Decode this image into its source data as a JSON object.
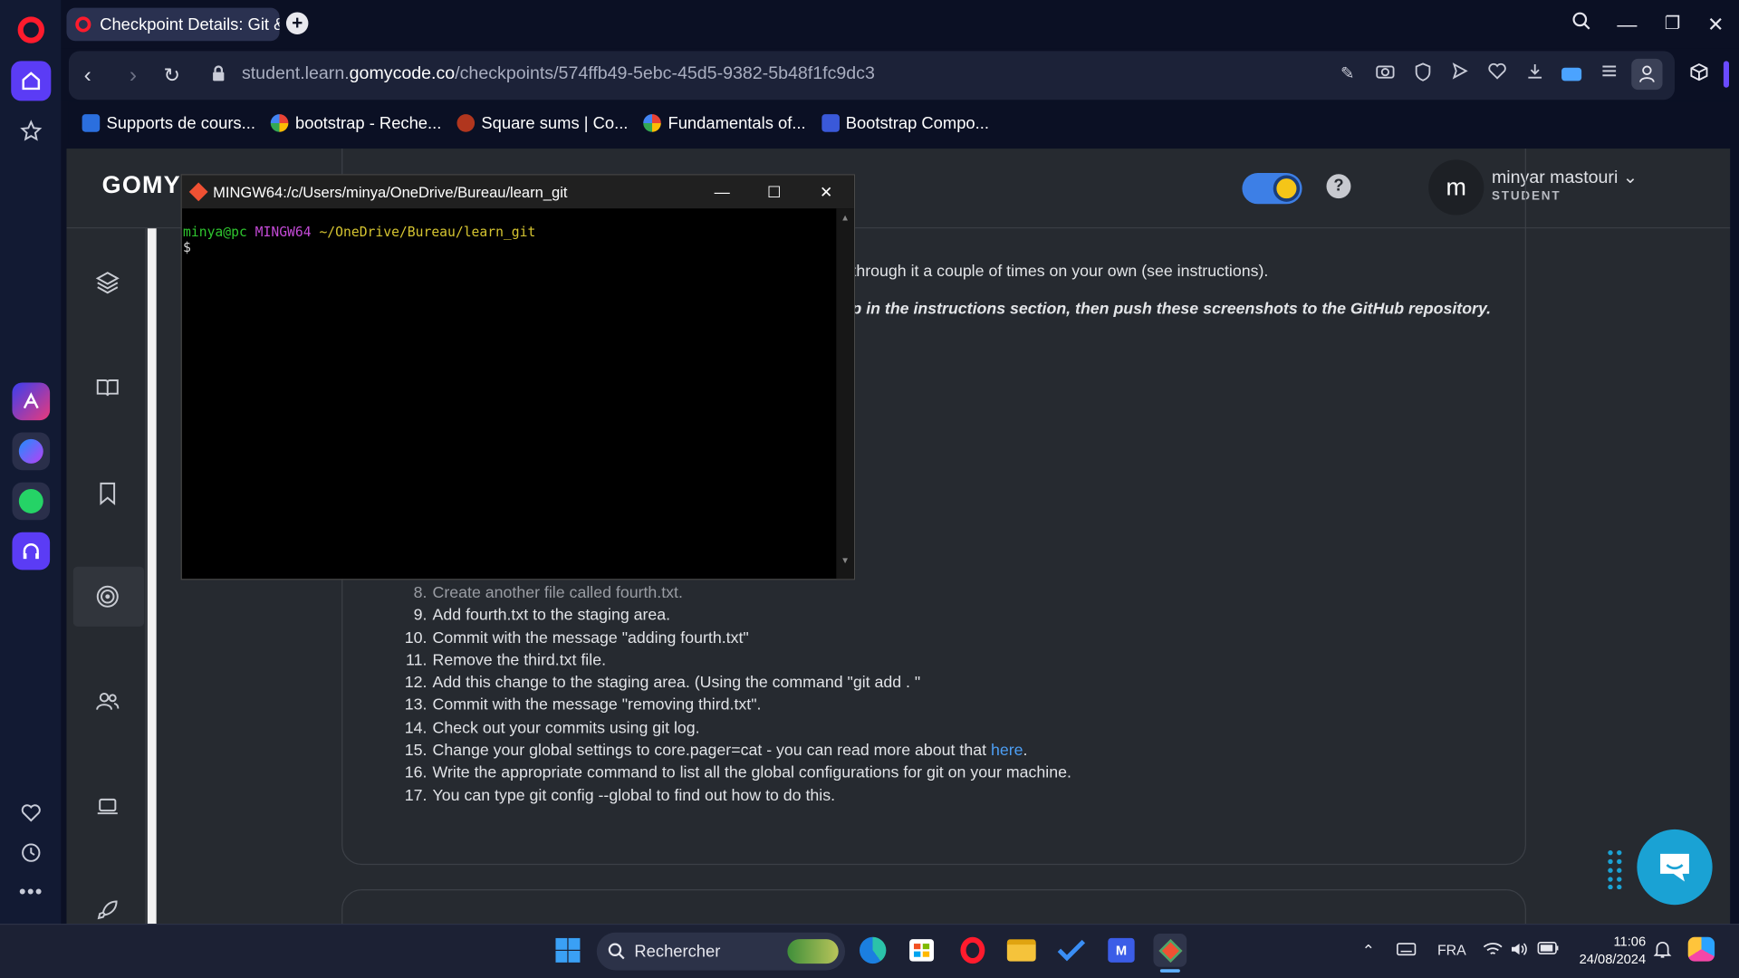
{
  "browser": {
    "tab_title": "Checkpoint Details: Git &",
    "url_prefix": "student.learn.",
    "url_domain": "gomycode.co",
    "url_path": "/checkpoints/574ffb49-5ebc-45d5-9382-5b48f1fc9dc3",
    "bookmarks": [
      {
        "label": "Supports de cours...",
        "icon": "screen-icon",
        "color": "#2b6fde"
      },
      {
        "label": "bootstrap - Reche...",
        "icon": "google-icon",
        "color": "#ffffff"
      },
      {
        "label": "Square sums | Co...",
        "icon": "codewars-icon",
        "color": "#b1361e"
      },
      {
        "label": "Fundamentals of...",
        "icon": "google-icon",
        "color": "#ffffff"
      },
      {
        "label": "Bootstrap Compo...",
        "icon": "bookmark-app-icon",
        "color": "#3a59d9"
      }
    ]
  },
  "site": {
    "logo": "GOMY",
    "user_initial": "m",
    "user_name": "minyar mastouri",
    "user_role": "STUDENT"
  },
  "content": {
    "line1": "through it a couple of times on your own (see instructions).",
    "line2": "p in the instructions section, then push these screenshots to the GitHub repository.",
    "steps": [
      {
        "num": "8.",
        "text": "Create another file called fourth.txt."
      },
      {
        "num": "9.",
        "text": "Add fourth.txt to the staging area."
      },
      {
        "num": "10.",
        "text": "Commit with the message \"adding fourth.txt\""
      },
      {
        "num": "11.",
        "text": "Remove the third.txt file."
      },
      {
        "num": "12.",
        "text": "Add this change to the staging area. (Using the command \"git add . \""
      },
      {
        "num": "13.",
        "text": "Commit with the message \"removing third.txt\"."
      },
      {
        "num": "14.",
        "text": "Check out your commits using git log."
      },
      {
        "num": "15.",
        "text": "Change your global settings to core.pager=cat - you can read more about that ",
        "link": "here",
        "after": "."
      },
      {
        "num": "16.",
        "text": "Write the appropriate command to list all the global configurations for git on your machine."
      },
      {
        "num": "17.",
        "text": "You can type git config --global to find out how to do this."
      }
    ]
  },
  "terminal": {
    "title": "MINGW64:/c/Users/minya/OneDrive/Bureau/learn_git",
    "prompt_user": "minya@pc",
    "prompt_env": "MINGW64",
    "prompt_path": "~/OneDrive/Bureau/learn_git",
    "prompt_symbol": "$",
    "colors": {
      "user": "#2fc62f",
      "env": "#c34ad6",
      "path": "#d6c531"
    }
  },
  "taskbar": {
    "search_placeholder": "Rechercher",
    "language": "FRA",
    "time": "11:06",
    "date": "24/08/2024"
  },
  "colors": {
    "opera_red": "#ff1b2d",
    "accent_purple": "#5b3cf5",
    "chat_button": "#1aa2d4",
    "link": "#4d9ff5"
  }
}
